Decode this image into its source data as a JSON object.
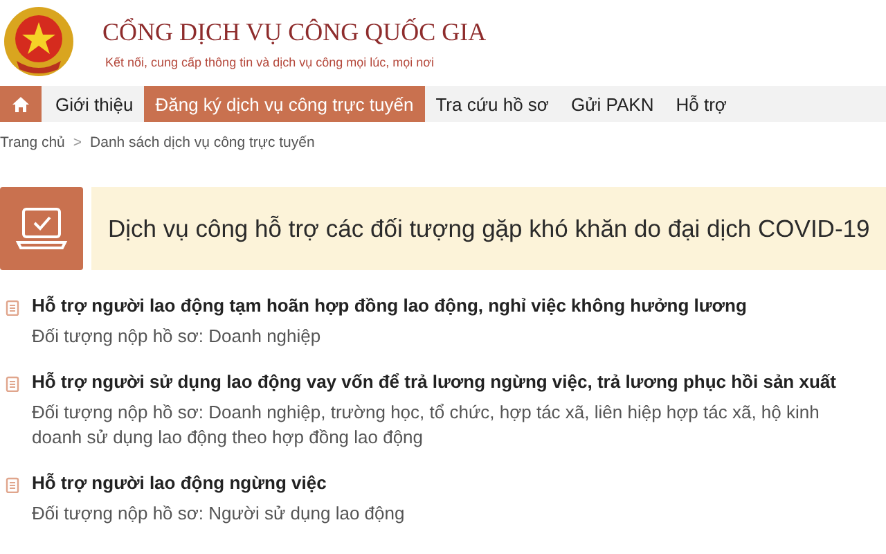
{
  "header": {
    "title": "CỔNG DỊCH VỤ CÔNG QUỐC GIA",
    "subtitle": "Kết nối, cung cấp thông tin và dịch vụ công mọi lúc, mọi nơi"
  },
  "nav": [
    {
      "kind": "home",
      "selected": false
    },
    {
      "kind": "text",
      "label": "Giới thiệu",
      "selected": false
    },
    {
      "kind": "text",
      "label": "Đăng ký dịch vụ công trực tuyến",
      "selected": true
    },
    {
      "kind": "text",
      "label": "Tra cứu hồ sơ",
      "selected": false
    },
    {
      "kind": "text",
      "label": "Gửi PAKN",
      "selected": false
    },
    {
      "kind": "text",
      "label": "Hỗ trợ",
      "selected": false
    }
  ],
  "breadcrumb": {
    "items": [
      "Trang chủ",
      "Danh sách dịch vụ công trực tuyến"
    ],
    "separator": ">"
  },
  "banner": {
    "title": "Dịch vụ công hỗ trợ các đối tượng gặp khó khăn do đại dịch COVID-19"
  },
  "services": [
    {
      "title": "Hỗ trợ người lao động tạm hoãn hợp đồng lao động, nghỉ việc không hưởng lương",
      "subject": "Đối tượng nộp hồ sơ: Doanh nghiệp"
    },
    {
      "title": "Hỗ trợ người sử dụng lao động vay vốn để trả lương ngừng việc, trả lương phục hồi sản xuất",
      "subject": "Đối tượng nộp hồ sơ: Doanh nghiệp, trường học, tổ chức, hợp tác xã, liên hiệp hợp tác xã, hộ kinh doanh sử dụng lao động theo hợp đồng lao động"
    },
    {
      "title": "Hỗ trợ người lao động ngừng việc",
      "subject": "Đối tượng nộp hồ sơ: Người sử dụng lao động"
    }
  ]
}
